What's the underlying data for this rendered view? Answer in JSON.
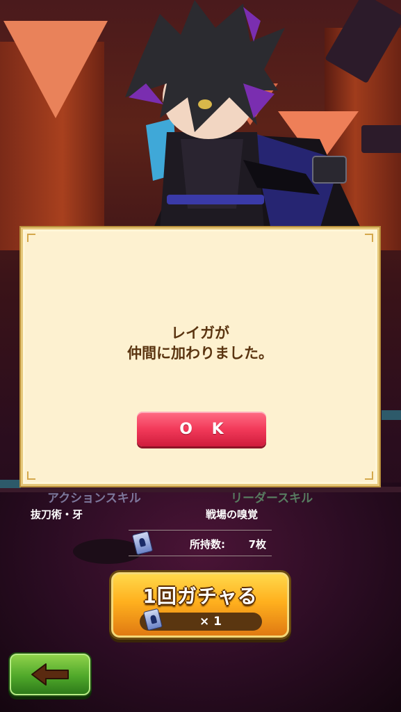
{
  "dialog": {
    "message_line1": "レイガが",
    "message_line2": "仲間に加わりました。",
    "ok_label": "O K"
  },
  "skills": {
    "action_header": "アクションスキル",
    "action_value": "抜刀術・牙",
    "leader_header": "リーダースキル",
    "leader_value": "戦場の嗅覚"
  },
  "owned": {
    "label": "所持数:",
    "count": "7枚"
  },
  "gacha": {
    "title": "1回ガチャる",
    "cost": "× 1"
  },
  "icons": {
    "ticket": "ticket-icon",
    "back": "back-arrow-icon"
  },
  "colors": {
    "dialog_bg": "#fdf1d0",
    "ok_button": "#f23a5a",
    "gacha_button": "#ffb01e",
    "back_button": "#4fa82a"
  }
}
